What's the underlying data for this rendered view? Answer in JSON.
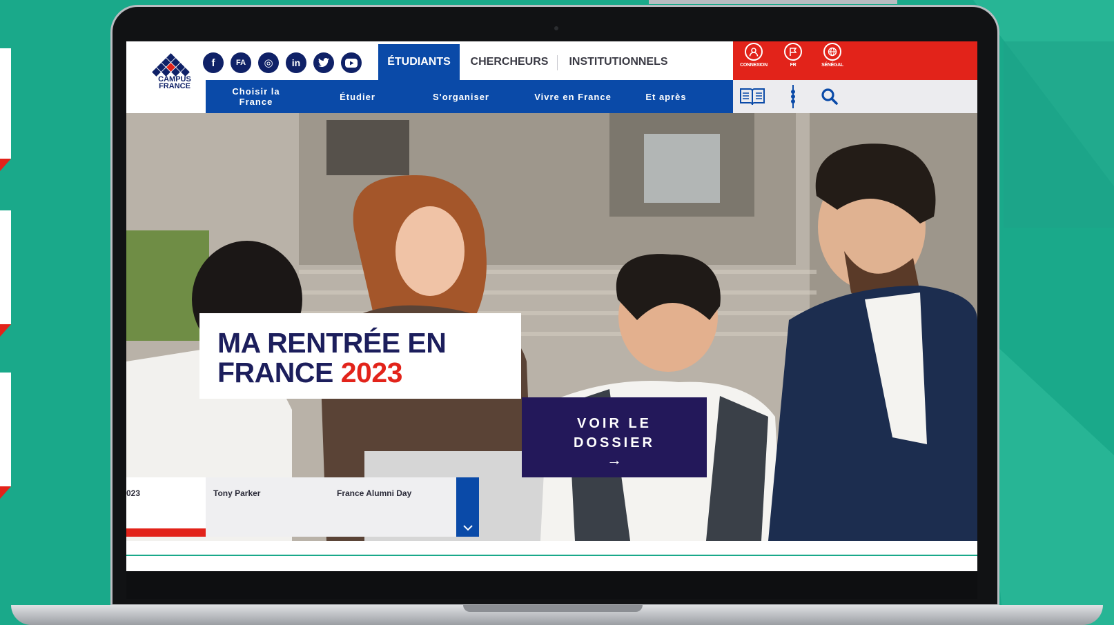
{
  "brand": {
    "logo_line1": "CAMPUS",
    "logo_line2": "FRANCE"
  },
  "social": [
    {
      "name": "facebook-icon",
      "glyph": "f"
    },
    {
      "name": "france-alumni-icon",
      "glyph": "FA"
    },
    {
      "name": "instagram-icon",
      "glyph": "◎"
    },
    {
      "name": "linkedin-icon",
      "glyph": "in"
    },
    {
      "name": "twitter-icon",
      "glyph": "🐦"
    },
    {
      "name": "youtube-icon",
      "glyph": "▶"
    }
  ],
  "audience_tabs": [
    {
      "label": "ÉTUDIANTS",
      "active": true
    },
    {
      "label": "CHERCHEURS",
      "active": false
    },
    {
      "label": "INSTITUTIONNELS",
      "active": false
    }
  ],
  "utility": {
    "connexion": "CONNEXION",
    "language": "FR",
    "country": "SÉNÉGAL"
  },
  "nav": [
    {
      "label": "Choisir la France"
    },
    {
      "label": "Étudier"
    },
    {
      "label": "S'organiser"
    },
    {
      "label": "Vivre en France"
    },
    {
      "label": "Et après"
    }
  ],
  "tools": {
    "catalog_icon": "book-icon",
    "menu_icon": "more-vertical-icon",
    "search_icon": "search-icon"
  },
  "hero": {
    "title_line1": "MA RENTRÉE EN",
    "title_line2": "FRANCE",
    "title_year": "2023",
    "cta_line1": "VOIR LE",
    "cta_line2": "DOSSIER",
    "cta_arrow": "→"
  },
  "news": [
    "023",
    "Tony Parker",
    "France Alumni Day"
  ],
  "colors": {
    "green": "#1aa98a",
    "blue": "#0a4aa8",
    "navy": "#1c1e5c",
    "red": "#e2231a"
  }
}
